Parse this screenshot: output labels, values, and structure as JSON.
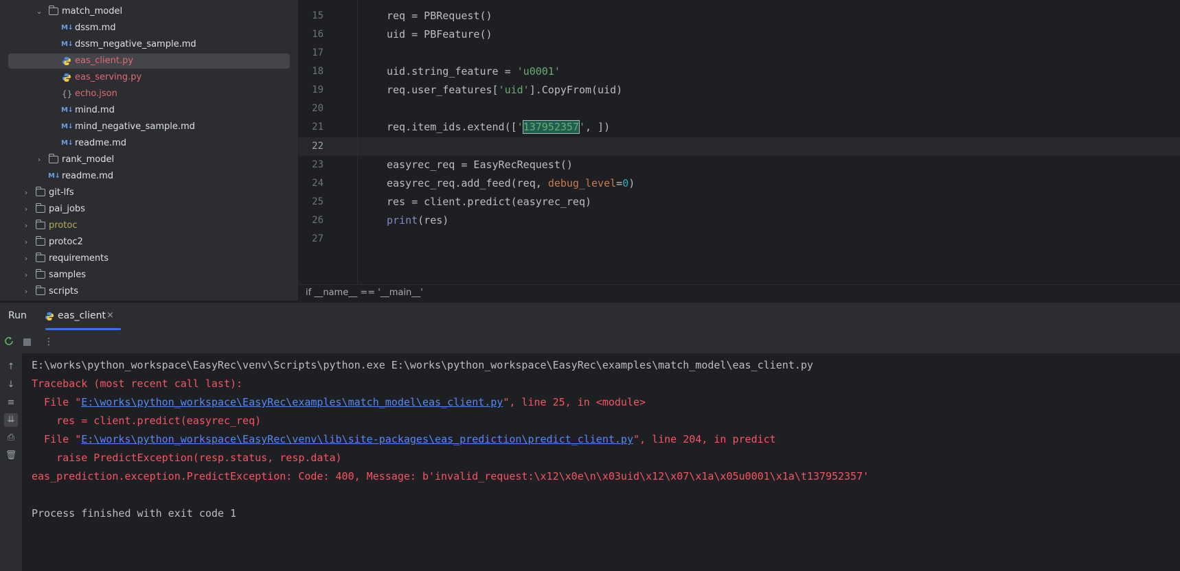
{
  "project_tree": {
    "items": [
      {
        "label": "match_model",
        "kind": "folder",
        "expanded": true
      },
      {
        "label": "dssm.md",
        "kind": "md"
      },
      {
        "label": "dssm_negative_sample.md",
        "kind": "md"
      },
      {
        "label": "eas_client.py",
        "kind": "py",
        "selected": true
      },
      {
        "label": "eas_serving.py",
        "kind": "py"
      },
      {
        "label": "echo.json",
        "kind": "json"
      },
      {
        "label": "mind.md",
        "kind": "md"
      },
      {
        "label": "mind_negative_sample.md",
        "kind": "md"
      },
      {
        "label": "readme.md",
        "kind": "md"
      },
      {
        "label": "rank_model",
        "kind": "folder",
        "expanded": false
      },
      {
        "label": "readme.md",
        "kind": "md"
      },
      {
        "label": "git-lfs",
        "kind": "folder"
      },
      {
        "label": "pai_jobs",
        "kind": "folder"
      },
      {
        "label": "protoc",
        "kind": "folder"
      },
      {
        "label": "protoc2",
        "kind": "folder"
      },
      {
        "label": "requirements",
        "kind": "folder"
      },
      {
        "label": "samples",
        "kind": "folder"
      },
      {
        "label": "scripts",
        "kind": "folder"
      }
    ]
  },
  "editor": {
    "line_numbers": [
      "15",
      "16",
      "17",
      "18",
      "19",
      "20",
      "21",
      "22",
      "23",
      "24",
      "25",
      "26",
      "27"
    ],
    "current_line": "22",
    "lines": {
      "l15": "req = PBRequest()",
      "l16": "uid = PBFeature()",
      "l18_a": "uid.string_feature = ",
      "l18_b": "'u0001'",
      "l19_a": "req.user_features[",
      "l19_b": "'uid'",
      "l19_c": "].CopyFrom(uid)",
      "l21_a": "req.item_ids.extend([",
      "l21_b": "'",
      "l21_c": "137952357",
      "l21_d": "'",
      "l21_e": ", ])",
      "l23": "easyrec_req = EasyRecRequest()",
      "l24_a": "easyrec_req.add_feed(req, ",
      "l24_b": "debug_level",
      "l24_c": "=",
      "l24_d": "0",
      "l24_e": ")",
      "l25": "res = client.predict(easyrec_req)",
      "l26_a": "print",
      "l26_b": "(res)"
    },
    "breadcrumb": "if __name__ == '__main__'"
  },
  "run_panel": {
    "title": "Run",
    "tab_label": "eas_client",
    "tab_close": "×",
    "console": {
      "cmd": "E:\\works\\python_workspace\\EasyRec\\venv\\Scripts\\python.exe E:\\works\\python_workspace\\EasyRec\\examples\\match_model\\eas_client.py",
      "traceback": "Traceback (most recent call last):",
      "f1_pre": "  File \"",
      "f1_link": "E:\\works\\python_workspace\\EasyRec\\examples\\match_model\\eas_client.py",
      "f1_post": "\", line 25, in <module>",
      "f1_code": "    res = client.predict(easyrec_req)",
      "f2_pre": "  File \"",
      "f2_link": "E:\\works\\python_workspace\\EasyRec\\venv\\lib\\site-packages\\eas_prediction\\predict_client.py",
      "f2_post": "\", line 204, in predict",
      "f2_code": "    raise PredictException(resp.status, resp.data)",
      "exception": "eas_prediction.exception.PredictException: Code: 400, Message: b'invalid_request:\\x12\\x0e\\n\\x03uid\\x12\\x07\\x1a\\x05u0001\\x1a\\t137952357'",
      "finished": "Process finished with exit code 1"
    }
  },
  "colors": {
    "background": "#1e1f22",
    "panel": "#2b2d30",
    "error": "#f75464",
    "link": "#548af7",
    "string": "#6aab73",
    "accent": "#3574f0"
  }
}
